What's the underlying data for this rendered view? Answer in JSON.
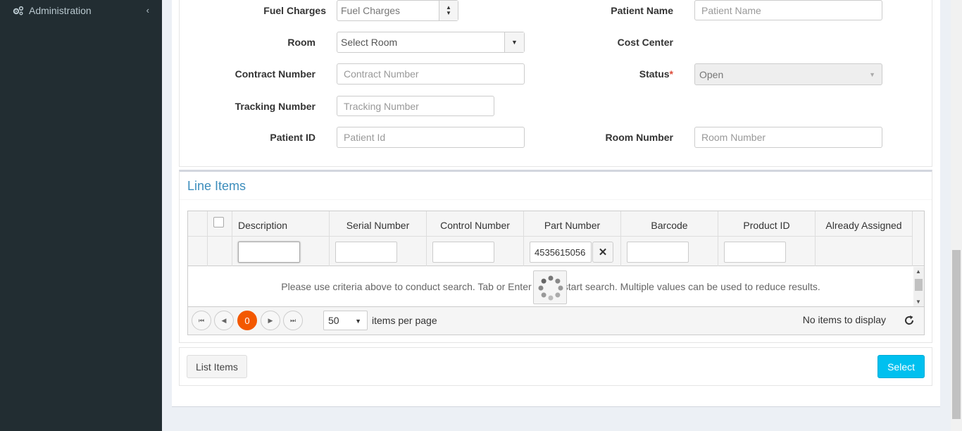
{
  "sidebar": {
    "items": [
      {
        "label": "Administration",
        "icon": "gears-icon"
      }
    ]
  },
  "form": {
    "fuel_charges": {
      "label": "Fuel Charges",
      "value": "Fuel Charges"
    },
    "patient_name": {
      "label": "Patient Name",
      "placeholder": "Patient Name"
    },
    "room": {
      "label": "Room",
      "value": "Select Room"
    },
    "cost_center": {
      "label": "Cost Center"
    },
    "contract_number": {
      "label": "Contract Number",
      "placeholder": "Contract Number"
    },
    "status": {
      "label": "Status",
      "required_mark": "*",
      "value": "Open"
    },
    "tracking_number": {
      "label": "Tracking Number",
      "placeholder": "Tracking Number"
    },
    "patient_id": {
      "label": "Patient ID",
      "placeholder": "Patient Id"
    },
    "room_number": {
      "label": "Room Number",
      "placeholder": "Room Number"
    }
  },
  "line_items": {
    "title": "Line Items",
    "columns": [
      "Description",
      "Serial Number",
      "Control Number",
      "Part Number",
      "Barcode",
      "Product ID",
      "Already Assigned"
    ],
    "part_number_filter": "4535615056",
    "empty_message": "Please use criteria above to conduct search. Tab or Enter key to start search. Multiple values can be used to reduce results.",
    "pager": {
      "current_page": "0",
      "page_size": "50",
      "items_per_page_label": "items per page",
      "no_items": "No items to display"
    }
  },
  "footer": {
    "list_items_label": "List Items",
    "select_label": "Select"
  },
  "colors": {
    "sidebar_bg": "#222d32",
    "accent_blue": "#3c8dbc",
    "select_button": "#00c0ef",
    "active_page": "#f35800",
    "required": "#dd4b39"
  }
}
